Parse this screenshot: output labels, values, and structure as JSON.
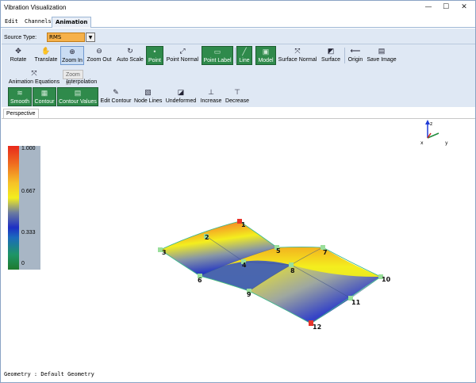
{
  "window": {
    "title": "Vibration Visualization",
    "controls": {
      "minimize": "—",
      "maximize": "☐",
      "close": "✕"
    }
  },
  "menu": {
    "tabs": [
      {
        "label": "Edit"
      },
      {
        "label": "Channels"
      },
      {
        "label": "Animation",
        "active": true
      }
    ]
  },
  "source": {
    "label": "Source Type:",
    "value": "RMS"
  },
  "toolbar": {
    "rotate": "Rotate",
    "translate": "Translate",
    "zoom_in": "Zoom In",
    "zoom_out": "Zoom Out",
    "auto_scale": "Auto Scale",
    "point": "Point",
    "point_normal": "Point Normal",
    "point_label": "Point Label",
    "line": "Line",
    "model": "Model",
    "surface_normal": "Surface Normal",
    "surface": "Surface",
    "origin": "Origin",
    "save_image": "Save Image"
  },
  "animation": {
    "equations": "Animation Equations",
    "interpolation": "Interpolation",
    "zoom_tag": "Zoom In"
  },
  "contour": {
    "smooth": "Smooth",
    "contour": "Contour",
    "contour_values": "Contour Values",
    "edit_contour": "Edit Contour",
    "node_lines": "Node Lines",
    "undeformed": "Undeformed",
    "increase": "Increase",
    "decrease": "Decrease"
  },
  "viewport": {
    "tab": "Perspective",
    "legend": {
      "max": "1.000",
      "mid_high": "0.667",
      "mid_low": "0.333",
      "min": "0"
    },
    "axes": {
      "x": "x",
      "y": "y",
      "z": "z"
    },
    "nodes": [
      "1",
      "2",
      "3",
      "4",
      "5",
      "6",
      "7",
      "8",
      "9",
      "10",
      "11",
      "12"
    ]
  },
  "status": {
    "geometry": "Geometry : Default Geometry"
  },
  "colors": {
    "accent_green": "#2f8a4b",
    "ribbon": "#dfe8f4",
    "select": "#f6b14a",
    "legend_bg": "#a8b6c5"
  }
}
